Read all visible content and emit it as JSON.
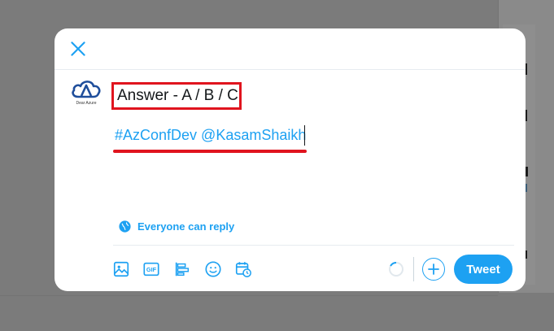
{
  "colors": {
    "accent": "#1da1f2",
    "highlight": "#e0141e",
    "text": "#14171a"
  },
  "header": {
    "close_icon": "close-icon"
  },
  "avatar": {
    "label": "Dear Azure"
  },
  "composer": {
    "line1": "Answer - A / B / C",
    "line2": "#AzConfDev @KasamShaikh"
  },
  "reply_setting": {
    "icon": "globe-icon",
    "label": "Everyone can reply"
  },
  "toolbar": {
    "icons": [
      "image-icon",
      "gif-icon",
      "poll-icon",
      "emoji-icon",
      "schedule-icon"
    ],
    "add_icon": "plus-icon",
    "tweet_label": "Tweet"
  }
}
